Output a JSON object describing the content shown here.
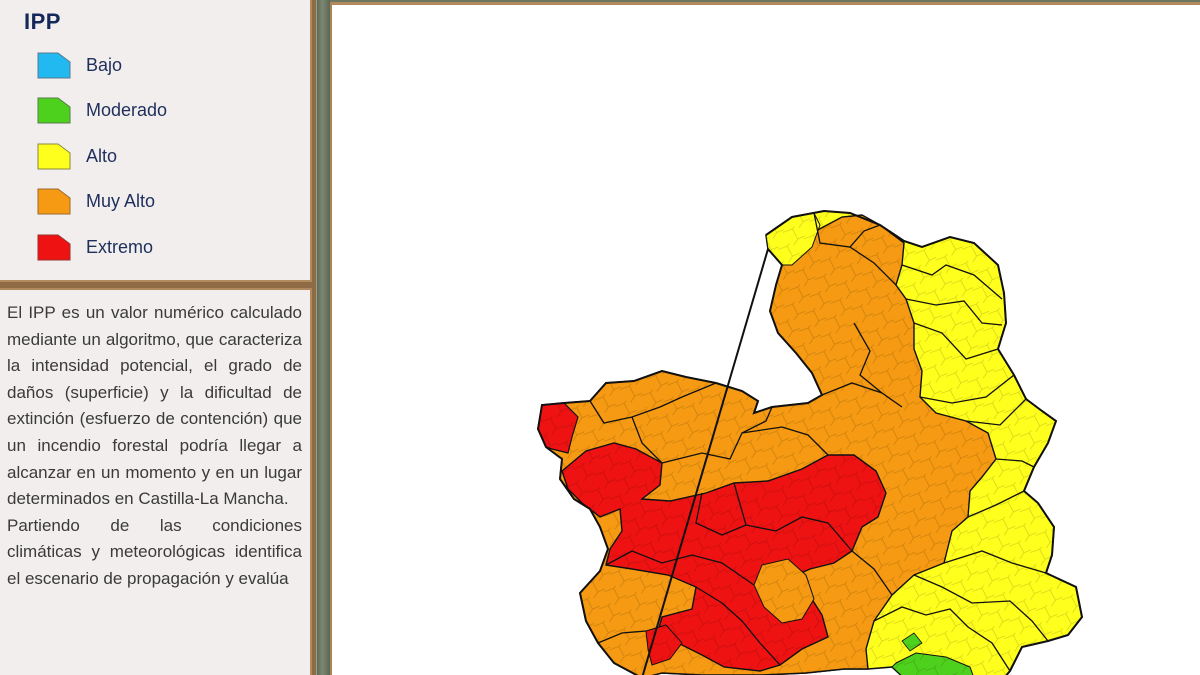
{
  "legend": {
    "title": "IPP",
    "items": [
      {
        "label": "Bajo",
        "color": "#22b8f0"
      },
      {
        "label": "Moderado",
        "color": "#4ed11c"
      },
      {
        "label": "Alto",
        "color": "#ffff1e"
      },
      {
        "label": "Muy Alto",
        "color": "#f59a12"
      },
      {
        "label": "Extremo",
        "color": "#ef1212"
      }
    ]
  },
  "description": {
    "paragraph1": "El IPP es un valor numérico calculado mediante un algoritmo, que caracteriza la intensidad potencial, el grado de daños (superficie) y la dificultad de extinción (esfuerzo de contención) que un incendio forestal podría llegar a alcanzar en un momento y en un lugar determinados en Castilla-La Mancha.",
    "paragraph2": "Partiendo de las condiciones climáticas y meteorológicas identifica el escenario de propagación y evalúa"
  },
  "map": {
    "region": "Castilla-La Mancha",
    "icon": "fire-risk-map",
    "fill_colors": {
      "alto": "#ffff1e",
      "muy_alto": "#f59a12",
      "extremo": "#ef1212",
      "moderado": "#4ed11c"
    }
  }
}
